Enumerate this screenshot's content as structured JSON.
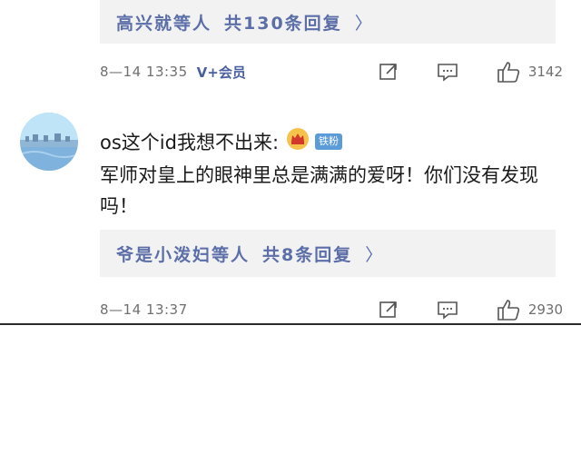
{
  "thread": {
    "prev_reply_summary": {
      "repliers_label": "高兴就等人",
      "count_label": "共130条回复",
      "chevron": "〉"
    },
    "prev_meta": {
      "timestamp": "8—14 13:35",
      "vip_label": "V+会员",
      "like_count": "3142"
    },
    "comment": {
      "username": "os这个id我想不出来:",
      "badge": "铁粉",
      "text": "军师对皇上的眼神里总是满满的爱呀！你们没有发现吗！",
      "reply_summary": {
        "repliers_label": "爷是小泼妇等人",
        "count_label": "共8条回复",
        "chevron": "〉"
      },
      "timestamp": "8—14 13:37",
      "like_count": "2930"
    }
  },
  "icons": {
    "share": "share-icon",
    "comment": "comment-icon",
    "like": "thumbs-up-icon",
    "crown": "crown-icon",
    "avatar": "avatar"
  },
  "colors": {
    "reply_link": "#5b6ea8",
    "reply_box_bg": "#f2f2f2",
    "meta_text": "#6f6f6f",
    "badge_bg": "#5a9bd8"
  }
}
